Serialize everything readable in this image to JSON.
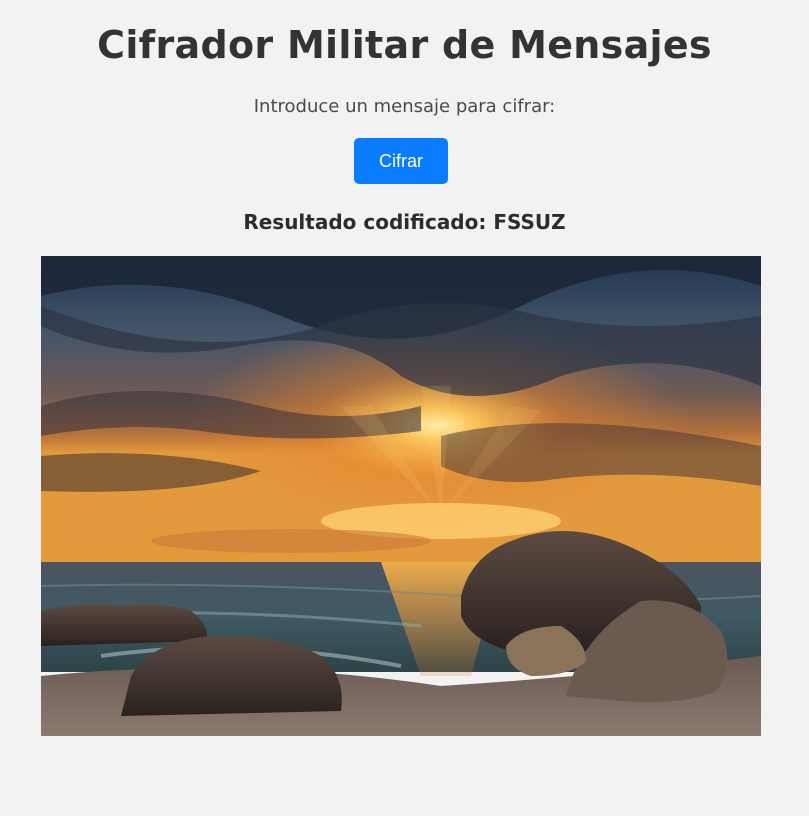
{
  "header": {
    "title": "Cifrador Militar de Mensajes"
  },
  "form": {
    "prompt": "Introduce un mensaje para cifrar:",
    "button_label": "Cifrar"
  },
  "result": {
    "text": "Resultado codificado: FSSUZ"
  },
  "image": {
    "subject": "sunset over sea with rocks on pebble beach"
  },
  "colors": {
    "background": "#f2f2f2",
    "button": "#0a7cff",
    "title": "#333333"
  }
}
